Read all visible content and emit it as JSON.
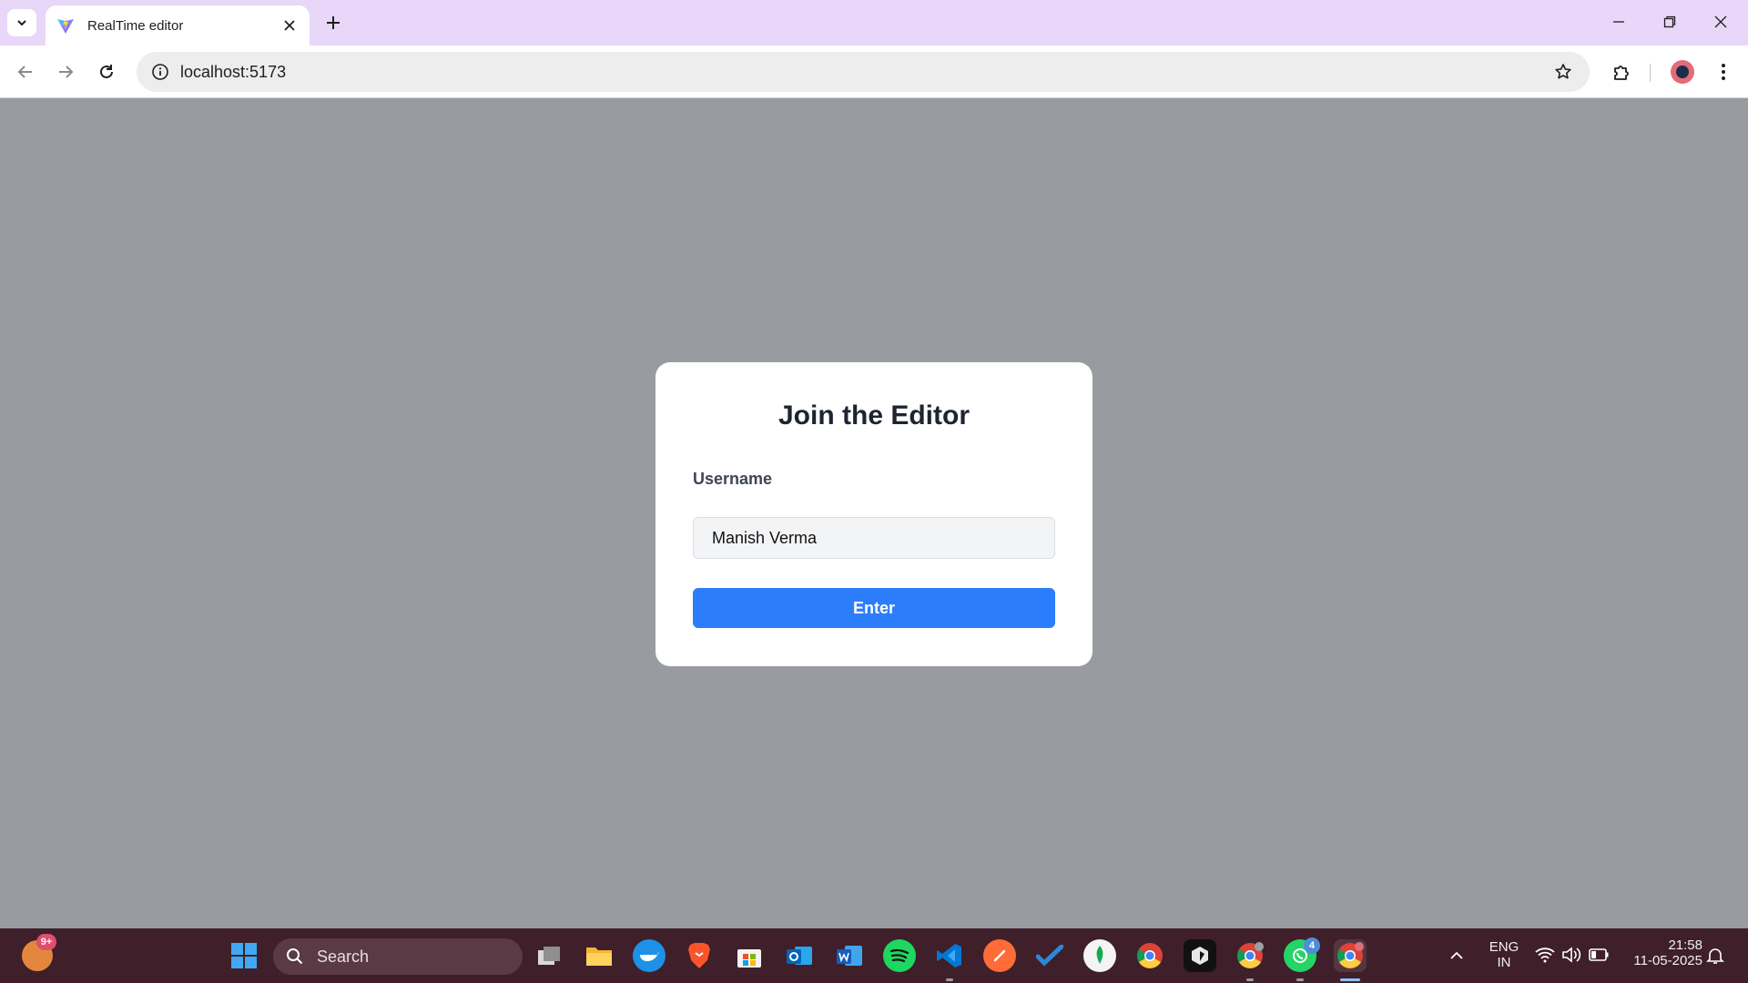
{
  "browser": {
    "tab_title": "RealTime editor",
    "url": "localhost:5173"
  },
  "page": {
    "title": "Join the Editor",
    "username_label": "Username",
    "username_value": "Manish Verma",
    "enter_label": "Enter"
  },
  "taskbar": {
    "weather_badge": "9+",
    "search_label": "Search",
    "whatsapp_badge": "4",
    "apps": [
      "task-view",
      "file-explorer",
      "docker",
      "brave",
      "microsoft-store",
      "outlook",
      "word",
      "spotify",
      "vscode",
      "postman",
      "todo",
      "mongodb-compass",
      "chrome",
      "cursor",
      "chrome-profile",
      "whatsapp",
      "chrome-active"
    ],
    "lang_line1": "ENG",
    "lang_line2": "IN",
    "time": "21:58",
    "date": "11-05-2025"
  },
  "colors": {
    "page_background": "#989ba0",
    "tabbar": "#e8d7f9",
    "primary_button": "#2c7dfb",
    "taskbar": "#3f1f2a"
  }
}
